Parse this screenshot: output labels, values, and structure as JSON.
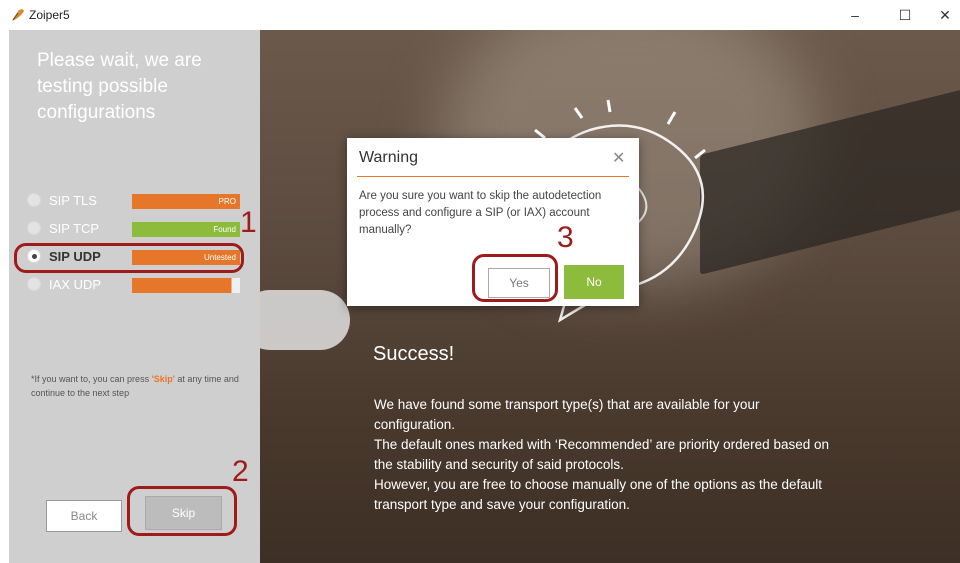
{
  "window": {
    "title": "Zoiper5",
    "minimize": "–",
    "maximize": "☐",
    "close": "✕"
  },
  "left_panel": {
    "heading": "Please wait, we are testing possible configurations",
    "transports": [
      {
        "label": "SIP TLS",
        "status": "PRO",
        "selected": false
      },
      {
        "label": "SIP TCP",
        "status": "Found",
        "selected": false
      },
      {
        "label": "SIP UDP",
        "status": "Untested",
        "selected": true
      },
      {
        "label": "IAX UDP",
        "status": "",
        "selected": false
      }
    ],
    "hint_prefix": "*If you want to, you can press ",
    "hint_skip_word": "'Skip'",
    "hint_suffix": " at any time and continue to the next step",
    "back_label": "Back",
    "skip_label": "Skip"
  },
  "main": {
    "success_title": "Success!",
    "paragraphs": [
      "We have found some transport type(s) that are available for your configuration.",
      "The default ones marked with ‘Recommended’ are priority ordered based on the stability and security of said protocols.",
      "However, you are free to choose manually one of the options as the default  transport type and save your configuration."
    ]
  },
  "dialog": {
    "title": "Warning",
    "close_glyph": "✕",
    "message": "Are you sure you want to skip the autodetection process and configure a SIP (or IAX) account manually?",
    "yes_label": "Yes",
    "no_label": "No"
  },
  "annotations": {
    "n1": "1",
    "n2": "2",
    "n3": "3"
  },
  "colors": {
    "accent_orange": "#e6772a",
    "accent_green": "#8dbb3c",
    "annotation_red": "#9e1b1b"
  }
}
